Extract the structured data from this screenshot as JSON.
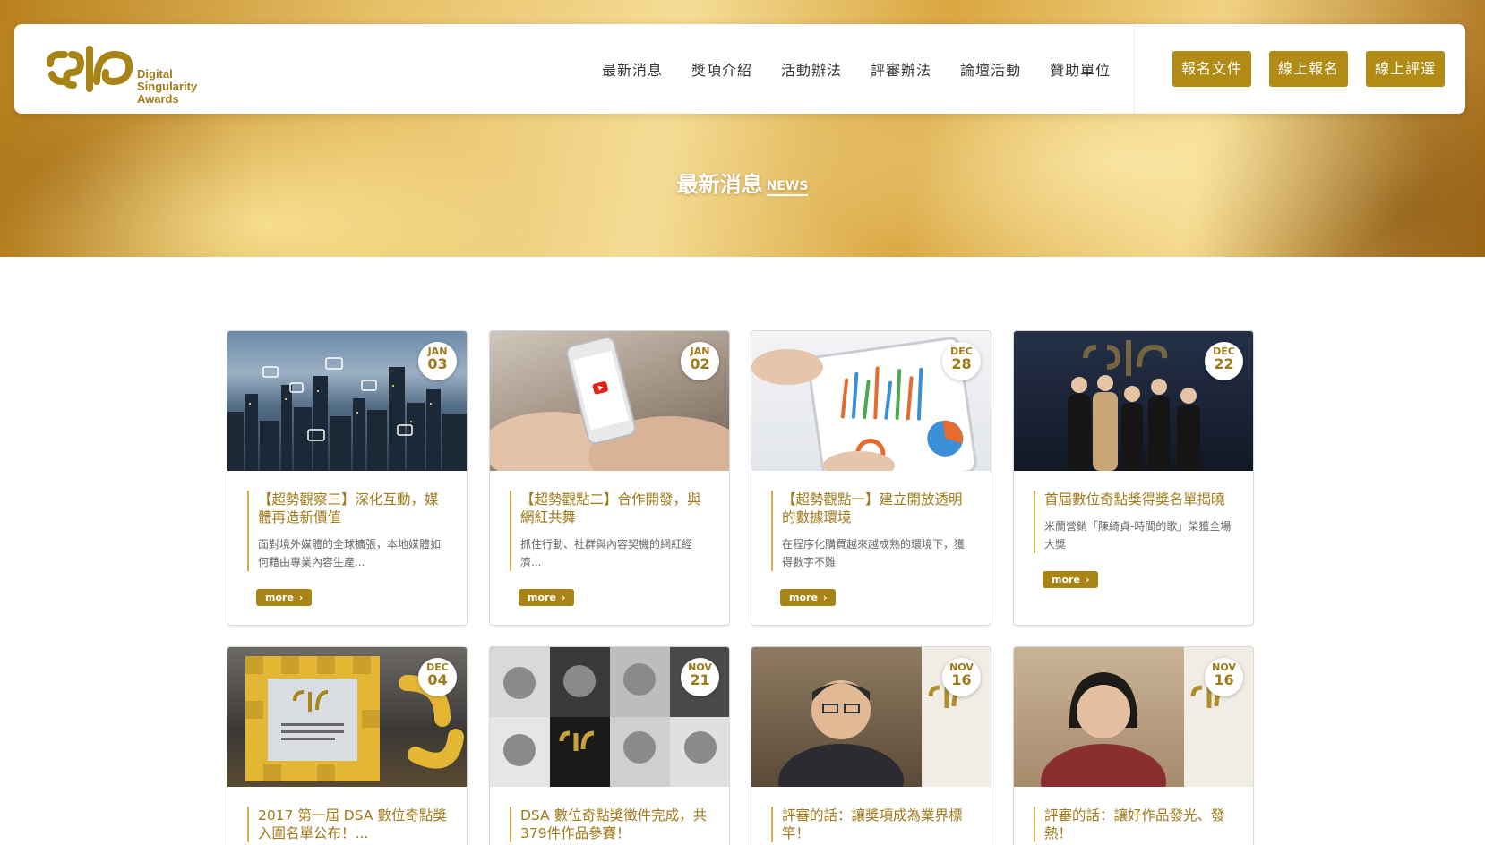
{
  "hero": {
    "title": "最新消息",
    "title_en": "NEWS"
  },
  "brand": {
    "logo_lines": [
      "Digital",
      "Singularity",
      "Awards"
    ],
    "accent_color": "#b28b15"
  },
  "nav": {
    "items": [
      "最新消息",
      "獎項介紹",
      "活動辦法",
      "評審辦法",
      "論壇活動",
      "贊助單位"
    ]
  },
  "actions": [
    "報名文件",
    "線上報名",
    "線上評選"
  ],
  "more_label": "more",
  "news": [
    {
      "month": "JAN",
      "day": "03",
      "title": "【超勢觀察三】深化互動，媒體再造新價值",
      "desc": "面對境外媒體的全球擴張，本地媒體如何藉由專業內容生產...",
      "image": "city-chat-bubbles"
    },
    {
      "month": "JAN",
      "day": "02",
      "title": "【超勢觀點二】合作開發，與網紅共舞",
      "desc": "抓住行動、社群與內容契機的網紅經濟...",
      "image": "phone-video"
    },
    {
      "month": "DEC",
      "day": "28",
      "title": "【超勢觀點一】建立開放透明的數據環境",
      "desc": "在程序化購買越來越成熟的環境下，獲得數字不難",
      "image": "tablet-charts"
    },
    {
      "month": "DEC",
      "day": "22",
      "title": "首屆數位奇點獎得獎名單揭曉",
      "desc": "米蘭營銷「陳綺貞-時間的歌」榮獲全場大獎",
      "image": "award-stage"
    },
    {
      "month": "DEC",
      "day": "04",
      "title": "2017 第一屆 DSA 數位奇點獎入圍名單公布！...",
      "desc": "",
      "image": "trophy-frame"
    },
    {
      "month": "NOV",
      "day": "21",
      "title": "DSA 數位奇點獎徵件完成，共379件作品參賽！",
      "desc": "",
      "image": "judges-grid"
    },
    {
      "month": "NOV",
      "day": "16",
      "title": "評審的話：讓獎項成為業界標竿！",
      "desc": "",
      "image": "judge-portrait-man"
    },
    {
      "month": "NOV",
      "day": "16",
      "title": "評審的話：讓好作品發光、發熱！",
      "desc": "",
      "image": "judge-portrait-woman"
    }
  ]
}
